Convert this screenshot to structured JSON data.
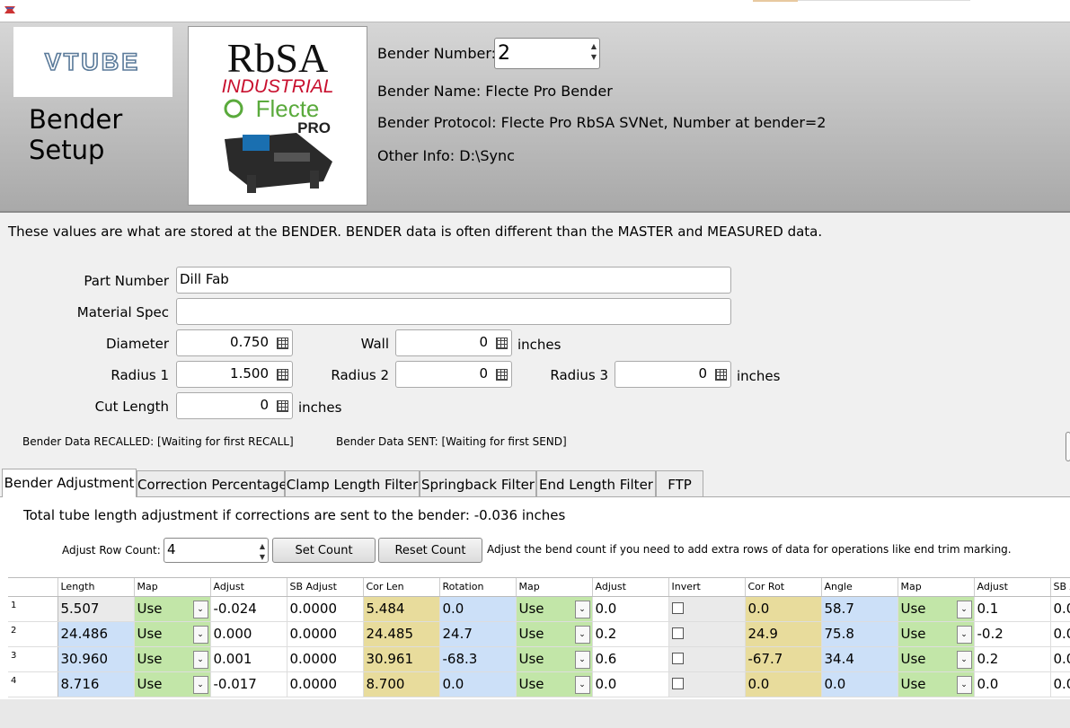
{
  "header": {
    "title": "Bender\nSetup",
    "vtube_logo_text": "VTUBE",
    "rbsa_logo": {
      "line1": "RbSA",
      "line2": "INDUSTRIAL",
      "line3": "Flecte",
      "line4": "PRO"
    },
    "bender_number_label": "Bender Number:",
    "bender_number_value": "2",
    "bender_name": "Bender Name: Flecte Pro Bender",
    "bender_protocol": "Bender Protocol: Flecte Pro RbSA SVNet, Number at bender=2",
    "other_info": "Other Info: D:\\Sync"
  },
  "info_text": "These values are what are stored at the BENDER.  BENDER data is often different than the MASTER and MEASURED data.",
  "form": {
    "part_number_label": "Part Number",
    "part_number_value": "Dill Fab",
    "material_spec_label": "Material Spec",
    "material_spec_value": "",
    "diameter_label": "Diameter",
    "diameter_value": "0.750",
    "wall_label": "Wall",
    "wall_value": "0",
    "radius1_label": "Radius 1",
    "radius1_value": "1.500",
    "radius2_label": "Radius 2",
    "radius2_value": "0",
    "radius3_label": "Radius 3",
    "radius3_value": "0",
    "cut_length_label": "Cut Length",
    "cut_length_value": "0",
    "unit": "inches"
  },
  "status": {
    "recalled": "Bender Data RECALLED: [Waiting for first RECALL]",
    "sent": "Bender Data SENT: [Waiting for first SEND]"
  },
  "tabs": [
    "Bender Adjustment",
    "Correction Percentage",
    "Clamp Length Filter",
    "Springback Filter",
    "End Length Filter",
    "FTP"
  ],
  "adjustment": {
    "total_text": "Total tube length adjustment if corrections are sent to the bender: -0.036 inches",
    "row_count_label": "Adjust Row Count:",
    "row_count_value": "4",
    "set_count_button": "Set Count",
    "reset_count_button": "Reset Count",
    "help_text": "Adjust the bend count if you need to add extra rows of data for operations like end trim marking."
  },
  "grid": {
    "columns": [
      "Length",
      "Map",
      "Adjust",
      "SB Adjust",
      "Cor Len",
      "Rotation",
      "Map",
      "Adjust",
      "Invert",
      "Cor Rot",
      "Angle",
      "Map",
      "Adjust",
      "SB A"
    ],
    "rows": [
      {
        "num": "1",
        "length": "5.507",
        "map1": "Use",
        "adjust1": "-0.024",
        "sb_adjust": "0.0000",
        "cor_len": "5.484",
        "rotation": "0.0",
        "map2": "Use",
        "adjust2": "0.0",
        "cor_rot": "0.0",
        "angle": "58.7",
        "map3": "Use",
        "adjust3": "0.1",
        "sb2": "0.0"
      },
      {
        "num": "2",
        "length": "24.486",
        "map1": "Use",
        "adjust1": "0.000",
        "sb_adjust": "0.0000",
        "cor_len": "24.485",
        "rotation": "24.7",
        "map2": "Use",
        "adjust2": "0.2",
        "cor_rot": "24.9",
        "angle": "75.8",
        "map3": "Use",
        "adjust3": "-0.2",
        "sb2": "0.0"
      },
      {
        "num": "3",
        "length": "30.960",
        "map1": "Use",
        "adjust1": "0.001",
        "sb_adjust": "0.0000",
        "cor_len": "30.961",
        "rotation": "-68.3",
        "map2": "Use",
        "adjust2": "0.6",
        "cor_rot": "-67.7",
        "angle": "34.4",
        "map3": "Use",
        "adjust3": "0.2",
        "sb2": "0.0"
      },
      {
        "num": "4",
        "length": "8.716",
        "map1": "Use",
        "adjust1": "-0.017",
        "sb_adjust": "0.0000",
        "cor_len": "8.700",
        "rotation": "0.0",
        "map2": "Use",
        "adjust2": "0.0",
        "cor_rot": "0.0",
        "angle": "0.0",
        "map3": "Use",
        "adjust3": "0.0",
        "sb2": "0.0"
      }
    ]
  },
  "colors": {
    "blue_cell": "#cce0f8",
    "green_cell": "#c2e6a8",
    "yellow_cell": "#e8dc9c",
    "rbsa_red": "#c8102e",
    "flecte_green": "#5aaa3c"
  }
}
